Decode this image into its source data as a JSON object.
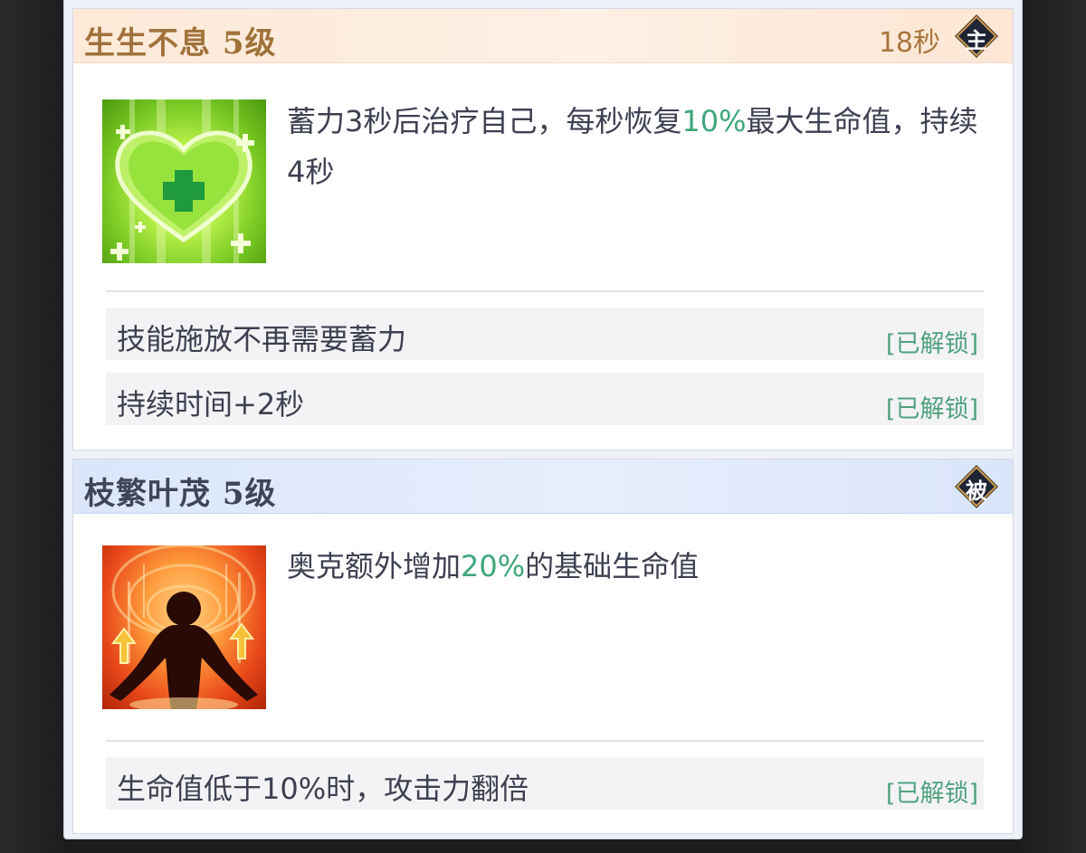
{
  "skills": [
    {
      "name": "生生不息 5级",
      "cooldown": "18秒",
      "type_badge": "主",
      "icon": "heart-heal-icon",
      "description": {
        "before": "蓄力3秒后治疗自己，每秒恢复",
        "highlight": "10%",
        "after": "最大生命值，持续4秒"
      },
      "effects": [
        {
          "text": "技能施放不再需要蓄力",
          "status": "[已解锁]"
        },
        {
          "text": "持续时间+2秒",
          "status": "[已解锁]"
        }
      ]
    },
    {
      "name": "枝繁叶茂 5级",
      "type_badge": "被",
      "icon": "power-up-silhouette-icon",
      "description": {
        "before": "奥克额外增加",
        "highlight": "20%",
        "after": "的基础生命值"
      },
      "effects": [
        {
          "text": "生命值低于10%时，攻击力翻倍",
          "status": "[已解锁]"
        }
      ]
    }
  ],
  "colors": {
    "highlight": "#3ea67a",
    "active_title": "#a0723b",
    "passive_title": "#3f4456",
    "unlocked": "#4fa27e"
  }
}
